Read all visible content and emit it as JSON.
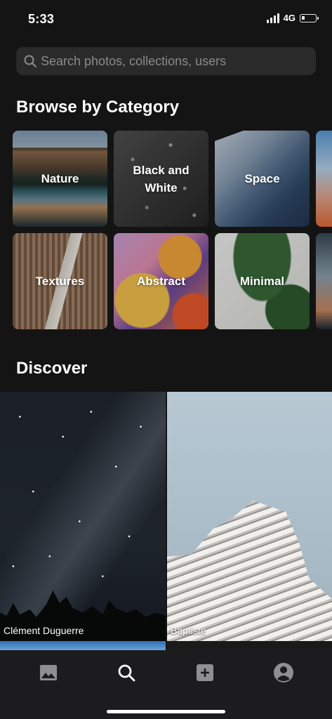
{
  "status_bar": {
    "time": "5:33",
    "network": "4G"
  },
  "search": {
    "placeholder": "Search photos, collections, users"
  },
  "browse": {
    "title": "Browse by Category",
    "categories": [
      {
        "label": "Nature"
      },
      {
        "label": "Black and White"
      },
      {
        "label": "Space"
      },
      {
        "label": "Textures"
      },
      {
        "label": "Abstract"
      },
      {
        "label": "Minimal"
      }
    ]
  },
  "discover": {
    "title": "Discover",
    "photos": [
      {
        "author": "Clément Duguerre"
      },
      {
        "author": "Baptiste"
      }
    ]
  },
  "tab_bar": {
    "items": [
      {
        "icon": "image-icon",
        "active": false
      },
      {
        "icon": "search-icon",
        "active": true
      },
      {
        "icon": "plus-square-icon",
        "active": false
      },
      {
        "icon": "user-circle-icon",
        "active": false
      }
    ],
    "active_color": "#ffffff",
    "inactive_color": "#8e8e93"
  },
  "colors": {
    "background": "#141414",
    "search_field": "#2a2a2a",
    "tab_bar": "#1c1c1e"
  }
}
